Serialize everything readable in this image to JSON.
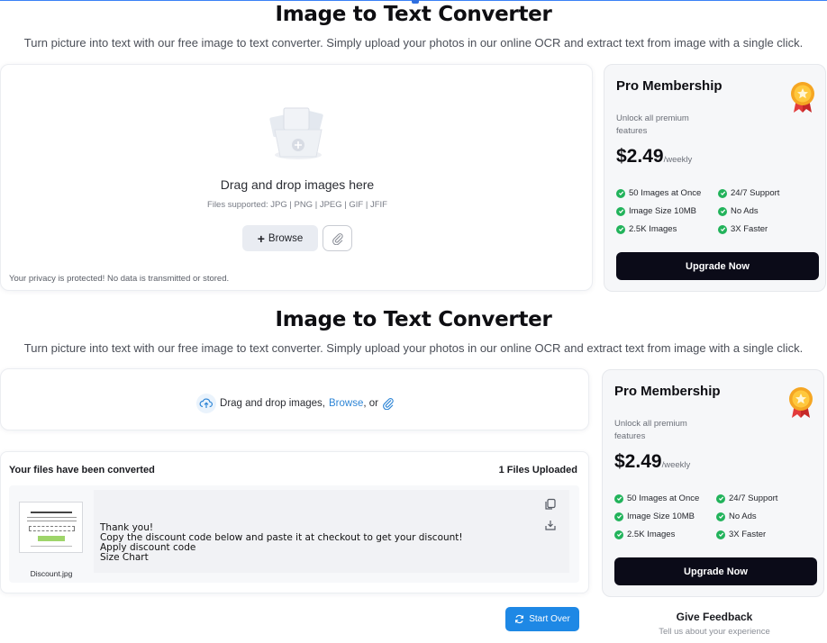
{
  "section1": {
    "title": "Image to Text Converter",
    "subtitle": "Turn picture into text with our free image to text converter. Simply upload your photos in our online OCR and extract text from image with a single click.",
    "upload": {
      "drag_text": "Drag and drop images here",
      "formats": "Files supported: JPG | PNG | JPEG | GIF | JFIF",
      "browse_label": "Browse",
      "privacy": "Your privacy is protected! No data is transmitted or stored."
    }
  },
  "pro": {
    "title": "Pro Membership",
    "description": "Unlock all premium features",
    "price": "$2.49",
    "period": "/weekly",
    "features": [
      "50 Images at Once",
      "24/7 Support",
      "Image Size 10MB",
      "No Ads",
      "2.5K Images",
      "3X Faster"
    ],
    "cta": "Upgrade Now"
  },
  "section2": {
    "title": "Image to Text Converter",
    "subtitle": "Turn picture into text with our free image to text converter. Simply upload your photos in our online OCR and extract text from image with a single click.",
    "upload": {
      "drag_prefix": "Drag and drop images,",
      "browse_link": "Browse",
      "or": ", or"
    },
    "results": {
      "heading": "Your files have been converted",
      "count": "1 Files Uploaded",
      "file_name": "Discount.jpg",
      "ocr_lines": [
        "Thank you!",
        "Copy the discount code below and paste it at checkout to get your discount!",
        "Apply discount code",
        "Size Chart"
      ]
    },
    "start_over": "Start Over"
  },
  "feedback": {
    "title": "Give Feedback",
    "subtitle": "Tell us about your experience"
  },
  "colors": {
    "accent_blue": "#1e88e5",
    "link_blue": "#2f86d6",
    "check_green": "#22b35b",
    "cta_dark": "#0b0b18"
  }
}
